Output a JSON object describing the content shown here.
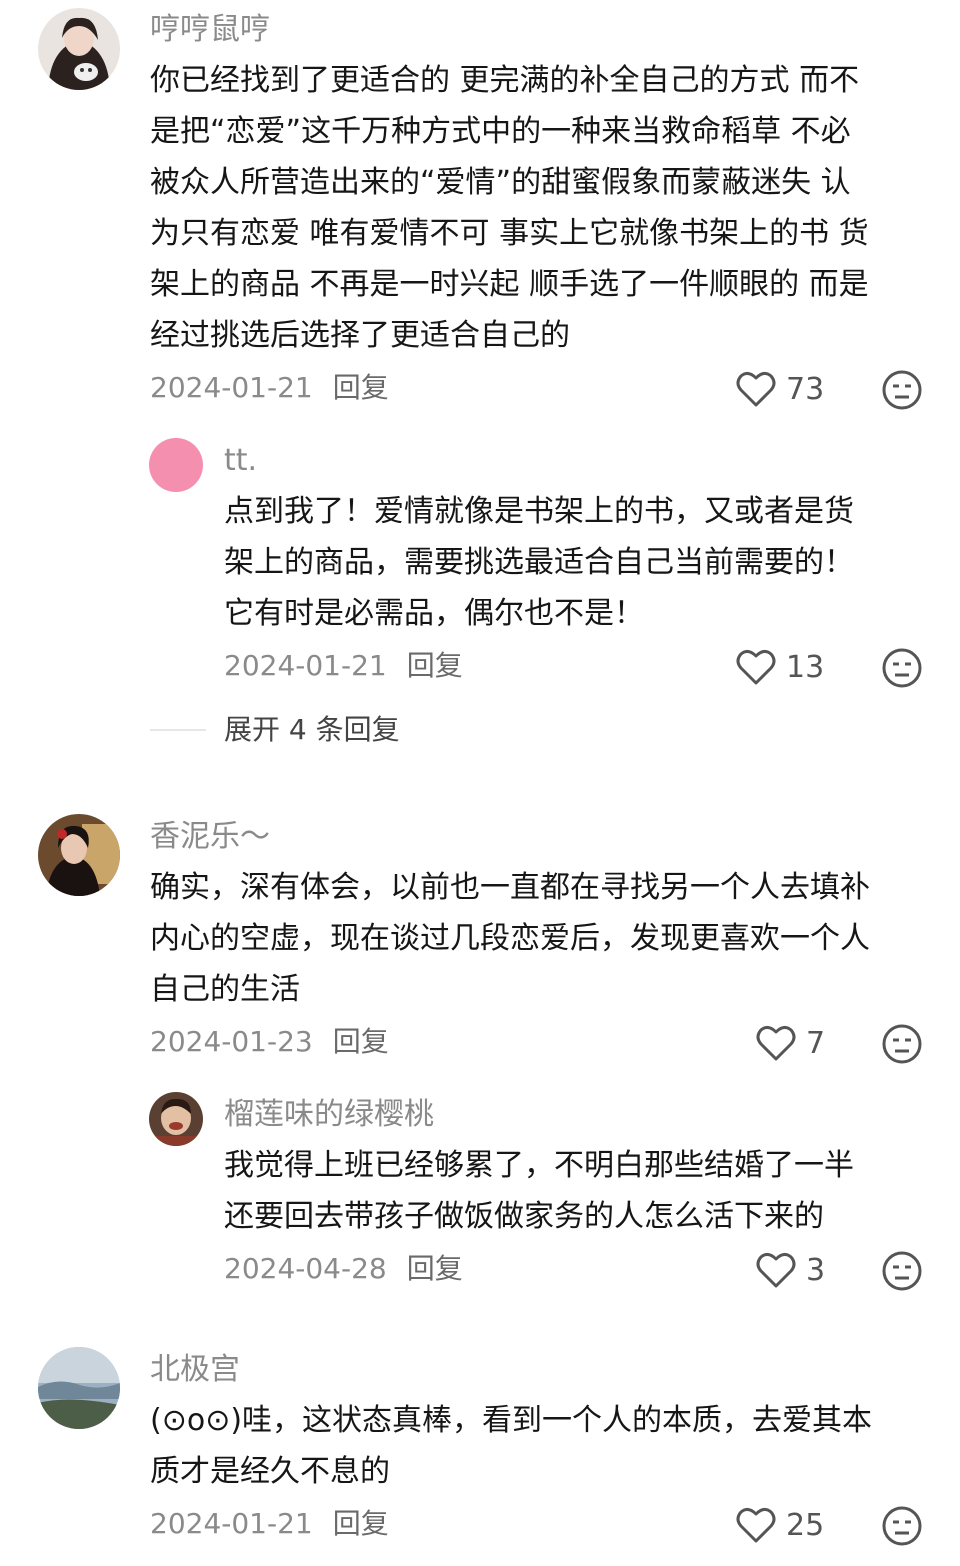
{
  "comments": [
    {
      "username": "哼哼鼠哼",
      "lines": [
        "你已经找到了更适合的 更完满的补全自己的方式 而不",
        "是把“恋爱”这千万种方式中的一种来当救命稻草  不必",
        "被众人所营造出来的“爱情”的甜蜜假象而蒙蔽迷失 认",
        "为只有恋爱 唯有爱情不可 事实上它就像书架上的书 货",
        "架上的商品 不再是一时兴起 顺手选了一件顺眼的  而是",
        "经过挑选后选择了更适合自己的"
      ],
      "date": "2024-01-21",
      "reply_label": "回复",
      "likes": "73"
    },
    {
      "username": "tt.",
      "lines": [
        "点到我了！爱情就像是书架上的书，又或者是货",
        "架上的商品，需要挑选最适合自己当前需要的！",
        "它有时是必需品，偶尔也不是！"
      ],
      "date": "2024-01-21",
      "reply_label": "回复",
      "likes": "13"
    },
    {
      "username": "香泥乐～",
      "lines": [
        "确实，深有体会，以前也一直都在寻找另一个人去填补",
        "内心的空虚，现在谈过几段恋爱后，发现更喜欢一个人",
        "自己的生活"
      ],
      "date": "2024-01-23",
      "reply_label": "回复",
      "likes": "7"
    },
    {
      "username": "榴莲味的绿樱桃",
      "lines": [
        "我觉得上班已经够累了，不明白那些结婚了一半",
        "还要回去带孩子做饭做家务的人怎么活下来的"
      ],
      "date": "2024-04-28",
      "reply_label": "回复",
      "likes": "3"
    },
    {
      "username": "北极宫",
      "lines": [
        "(⊙o⊙)哇，这状态真棒，看到一个人的本质，去爱其本",
        "质才是经久不息的"
      ],
      "date": "2024-01-21",
      "reply_label": "回复",
      "likes": "25"
    }
  ],
  "expand_replies": "展开 4 条回复",
  "icons": {
    "like": "heart-outline-icon",
    "react": "neutral-face-icon"
  },
  "colors": {
    "username": "#8a8a8a",
    "text": "#161616",
    "meta": "#8a8a8a",
    "avatar_pink": "#f58fb0"
  }
}
